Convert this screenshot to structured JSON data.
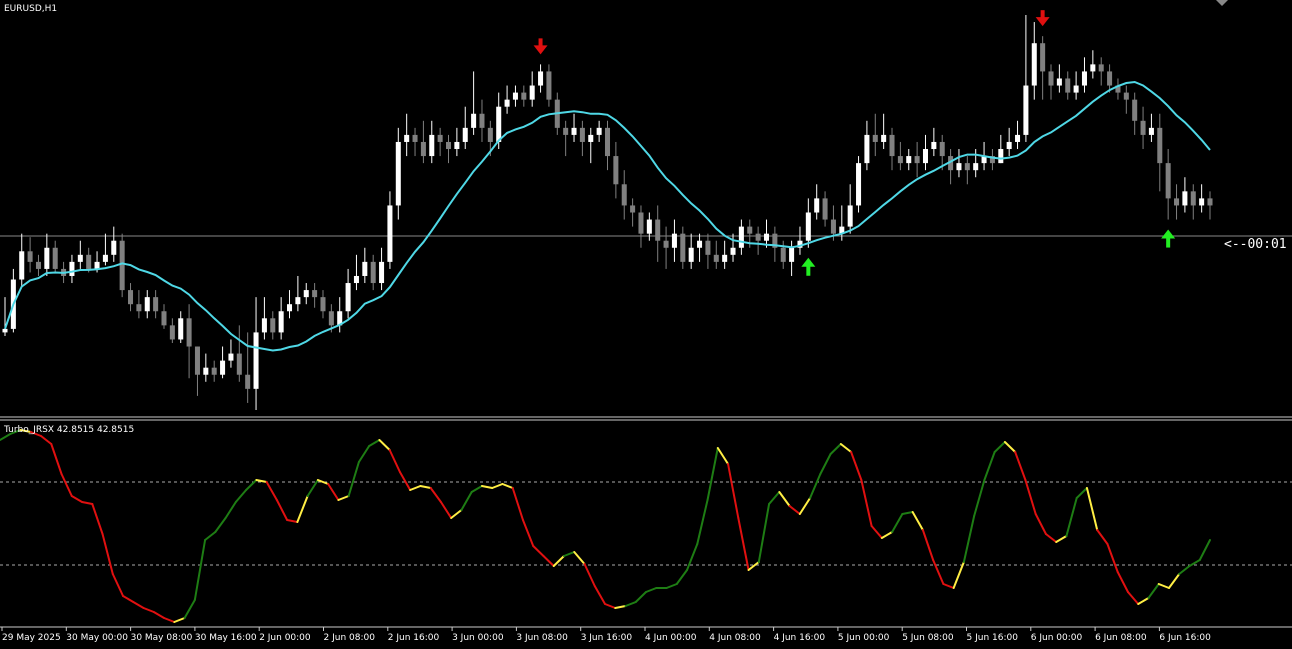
{
  "window": {
    "title": "EURUSD,H1"
  },
  "countdown": "<--00:01",
  "indicator": {
    "label": "Turbo_JRSX 42.8515 42.8515"
  },
  "colors": {
    "background": "#000000",
    "bull_candle": "#ffffff",
    "bear_candle": "#808080",
    "ma": "#4fd8e6",
    "osc_up": "#1e7d14",
    "osc_down": "#e01010",
    "osc_turn": "#ffee44",
    "arrow_sell": "#e01010",
    "arrow_buy": "#22ee22",
    "grid_text": "#ffffff"
  },
  "time_axis": {
    "labels": [
      "29 May 2025",
      "30 May 00:00",
      "30 May 08:00",
      "30 May 16:00",
      "2 Jun 00:00",
      "2 Jun 08:00",
      "2 Jun 16:00",
      "3 Jun 00:00",
      "3 Jun 08:00",
      "3 Jun 16:00",
      "4 Jun 00:00",
      "4 Jun 08:00",
      "4 Jun 16:00",
      "5 Jun 00:00",
      "5 Jun 08:00",
      "5 Jun 16:00",
      "6 Jun 00:00",
      "6 Jun 08:00",
      "6 Jun 16:00"
    ]
  },
  "chart_data": [
    {
      "type": "candlestick",
      "symbol": "EURUSD",
      "timeframe": "H1",
      "price_scale": "0 = lowest visible, 100 = highest visible (no price axis labels shown)",
      "candles_ohlc": [
        [
          30,
          31,
          40,
          29
        ],
        [
          31,
          45,
          48,
          30
        ],
        [
          45,
          53,
          58,
          43
        ],
        [
          53,
          50,
          57,
          47
        ],
        [
          50,
          48,
          52,
          46
        ],
        [
          48,
          54,
          58,
          46
        ],
        [
          54,
          48,
          56,
          47
        ],
        [
          48,
          46,
          50,
          44
        ],
        [
          46,
          50,
          52,
          44
        ],
        [
          50,
          52,
          56,
          48
        ],
        [
          52,
          48,
          54,
          47
        ],
        [
          48,
          50,
          53,
          47
        ],
        [
          50,
          52,
          58,
          49
        ],
        [
          52,
          56,
          60,
          50
        ],
        [
          56,
          42,
          58,
          40
        ],
        [
          42,
          38,
          44,
          36
        ],
        [
          38,
          36,
          42,
          34
        ],
        [
          36,
          40,
          42,
          34
        ],
        [
          40,
          36,
          42,
          34
        ],
        [
          36,
          32,
          38,
          31
        ],
        [
          32,
          28,
          34,
          27
        ],
        [
          28,
          34,
          36,
          27
        ],
        [
          34,
          26,
          38,
          17
        ],
        [
          26,
          18,
          26,
          12
        ],
        [
          18,
          20,
          24,
          16
        ],
        [
          20,
          18,
          22,
          16
        ],
        [
          18,
          22,
          26,
          17
        ],
        [
          22,
          24,
          28,
          20
        ],
        [
          24,
          18,
          32,
          16
        ],
        [
          18,
          14,
          30,
          10
        ],
        [
          14,
          30,
          40,
          8
        ],
        [
          30,
          34,
          40,
          28
        ],
        [
          34,
          30,
          36,
          28
        ],
        [
          30,
          36,
          40,
          28
        ],
        [
          36,
          38,
          42,
          34
        ],
        [
          38,
          40,
          46,
          36
        ],
        [
          40,
          42,
          44,
          38
        ],
        [
          42,
          40,
          44,
          37
        ],
        [
          40,
          36,
          42,
          34
        ],
        [
          36,
          32,
          38,
          30
        ],
        [
          32,
          36,
          40,
          30
        ],
        [
          36,
          44,
          48,
          34
        ],
        [
          44,
          46,
          52,
          42
        ],
        [
          46,
          50,
          54,
          44
        ],
        [
          50,
          44,
          52,
          42
        ],
        [
          44,
          50,
          54,
          42
        ],
        [
          50,
          66,
          70,
          48
        ],
        [
          66,
          84,
          88,
          62
        ],
        [
          84,
          86,
          92,
          80
        ],
        [
          86,
          84,
          88,
          80
        ],
        [
          84,
          80,
          90,
          78
        ],
        [
          80,
          86,
          90,
          78
        ],
        [
          86,
          84,
          88,
          80
        ],
        [
          84,
          82,
          86,
          78
        ],
        [
          82,
          84,
          88,
          80
        ],
        [
          84,
          88,
          94,
          82
        ],
        [
          88,
          92,
          104,
          86
        ],
        [
          92,
          88,
          96,
          84
        ],
        [
          88,
          84,
          90,
          80
        ],
        [
          84,
          94,
          98,
          82
        ],
        [
          94,
          96,
          100,
          92
        ],
        [
          96,
          98,
          100,
          94
        ],
        [
          98,
          96,
          100,
          94
        ],
        [
          96,
          100,
          104,
          94
        ],
        [
          100,
          104,
          106,
          98
        ],
        [
          104,
          96,
          106,
          94
        ],
        [
          96,
          88,
          98,
          86
        ],
        [
          88,
          86,
          90,
          80
        ],
        [
          86,
          88,
          92,
          84
        ],
        [
          88,
          84,
          90,
          80
        ],
        [
          84,
          86,
          88,
          78
        ],
        [
          86,
          88,
          90,
          84
        ],
        [
          88,
          80,
          90,
          76
        ],
        [
          80,
          72,
          84,
          68
        ],
        [
          72,
          66,
          76,
          62
        ],
        [
          66,
          64,
          68,
          60
        ],
        [
          64,
          58,
          66,
          54
        ],
        [
          58,
          62,
          64,
          56
        ],
        [
          62,
          56,
          66,
          50
        ],
        [
          56,
          54,
          60,
          48
        ],
        [
          54,
          58,
          62,
          50
        ],
        [
          58,
          50,
          60,
          48
        ],
        [
          50,
          54,
          58,
          48
        ],
        [
          54,
          56,
          58,
          50
        ],
        [
          56,
          52,
          58,
          48
        ],
        [
          52,
          50,
          56,
          48
        ],
        [
          50,
          52,
          56,
          48
        ],
        [
          52,
          54,
          58,
          50
        ],
        [
          54,
          60,
          62,
          52
        ],
        [
          60,
          58,
          62,
          54
        ],
        [
          58,
          56,
          60,
          52
        ],
        [
          56,
          58,
          62,
          54
        ],
        [
          58,
          54,
          60,
          50
        ],
        [
          54,
          50,
          56,
          48
        ],
        [
          50,
          54,
          56,
          46
        ],
        [
          54,
          56,
          60,
          52
        ],
        [
          56,
          64,
          68,
          54
        ],
        [
          64,
          68,
          72,
          62
        ],
        [
          68,
          62,
          70,
          60
        ],
        [
          62,
          58,
          66,
          56
        ],
        [
          58,
          60,
          66,
          56
        ],
        [
          60,
          66,
          72,
          58
        ],
        [
          66,
          78,
          80,
          64
        ],
        [
          78,
          86,
          90,
          76
        ],
        [
          86,
          84,
          92,
          80
        ],
        [
          84,
          86,
          92,
          82
        ],
        [
          86,
          80,
          88,
          76
        ],
        [
          80,
          78,
          84,
          76
        ],
        [
          78,
          80,
          82,
          76
        ],
        [
          80,
          78,
          84,
          74
        ],
        [
          78,
          82,
          86,
          76
        ],
        [
          82,
          84,
          88,
          80
        ],
        [
          84,
          80,
          86,
          76
        ],
        [
          80,
          76,
          82,
          72
        ],
        [
          76,
          78,
          82,
          74
        ],
        [
          78,
          76,
          80,
          72
        ],
        [
          76,
          78,
          82,
          74
        ],
        [
          78,
          80,
          84,
          76
        ],
        [
          80,
          78,
          82,
          76
        ],
        [
          78,
          82,
          86,
          78
        ],
        [
          82,
          84,
          88,
          80
        ],
        [
          84,
          86,
          90,
          82
        ],
        [
          86,
          100,
          120,
          84
        ],
        [
          100,
          112,
          118,
          96
        ],
        [
          112,
          104,
          114,
          96
        ],
        [
          104,
          100,
          106,
          96
        ],
        [
          100,
          102,
          106,
          98
        ],
        [
          102,
          98,
          104,
          96
        ],
        [
          98,
          100,
          104,
          96
        ],
        [
          100,
          104,
          108,
          98
        ],
        [
          104,
          106,
          110,
          102
        ],
        [
          106,
          104,
          108,
          100
        ],
        [
          104,
          100,
          106,
          98
        ],
        [
          100,
          98,
          102,
          96
        ],
        [
          98,
          96,
          100,
          92
        ],
        [
          96,
          90,
          98,
          86
        ],
        [
          90,
          86,
          94,
          82
        ],
        [
          86,
          88,
          92,
          84
        ],
        [
          88,
          78,
          92,
          70
        ],
        [
          78,
          68,
          82,
          62
        ],
        [
          68,
          66,
          72,
          62
        ],
        [
          66,
          70,
          74,
          64
        ],
        [
          70,
          66,
          72,
          62
        ],
        [
          66,
          68,
          72,
          64
        ],
        [
          68,
          66,
          70,
          62
        ]
      ],
      "ma": {
        "type": "line"
      },
      "signals": [
        {
          "type": "sell",
          "bar": 64
        },
        {
          "type": "buy",
          "bar": 96
        },
        {
          "type": "sell",
          "bar": 124
        },
        {
          "type": "buy",
          "bar": 139
        }
      ]
    },
    {
      "type": "line",
      "title": "Turbo_JRSX 42.8515 42.8515",
      "levels": [
        70,
        30
      ],
      "ylim": [
        0,
        100
      ],
      "series": [
        {
          "values": [
            92,
            95,
            97,
            96,
            94,
            90,
            75,
            64,
            61,
            60,
            45,
            25,
            14,
            11,
            8,
            6,
            3,
            1,
            3,
            12,
            42,
            46,
            53,
            61,
            67,
            72,
            71,
            62,
            52,
            51,
            64,
            72,
            70,
            62,
            64,
            81,
            89,
            92,
            87,
            76,
            67,
            69,
            68,
            61,
            53,
            57,
            66,
            69,
            68,
            70,
            68,
            52,
            39,
            34,
            29,
            34,
            36,
            30,
            19,
            10,
            8,
            9,
            11,
            16,
            18,
            18,
            20,
            27,
            40,
            62,
            88,
            80,
            53,
            27,
            31,
            60,
            66,
            59,
            55,
            63,
            75,
            85,
            90,
            86,
            72,
            49,
            43,
            46,
            55,
            56,
            47,
            32,
            20,
            18,
            31,
            54,
            72,
            86,
            91,
            86,
            72,
            55,
            45,
            41,
            44,
            63,
            68,
            47,
            40,
            26,
            16,
            10,
            13,
            20,
            18,
            25,
            29,
            32,
            42
          ]
        }
      ]
    }
  ]
}
